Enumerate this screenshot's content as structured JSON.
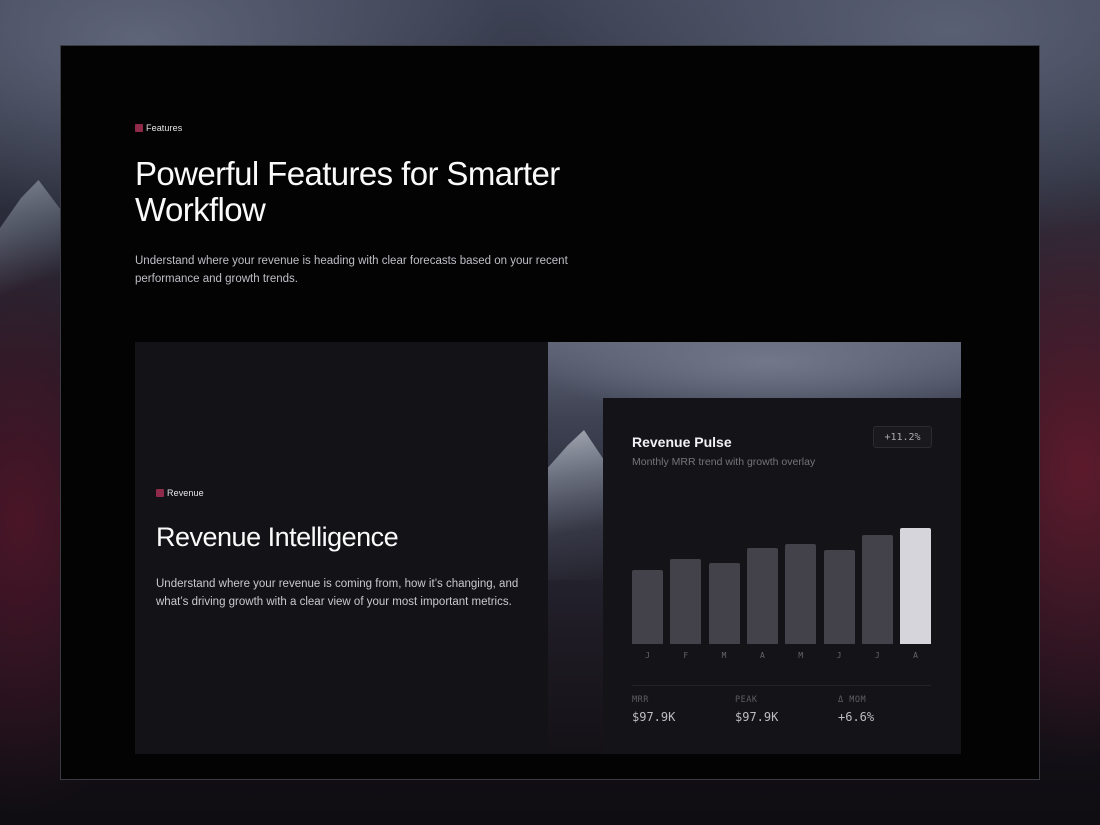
{
  "header": {
    "eyebrow": "Features",
    "title": "Powerful Features for Smarter Workflow",
    "description": "Understand where your revenue is heading with clear forecasts based on your recent performance and growth trends."
  },
  "feature": {
    "eyebrow": "Revenue",
    "title": "Revenue Intelligence",
    "description": "Understand where your revenue is coming from, how it’s changing, and what’s driving growth with a clear view of your most important metrics."
  },
  "colors": {
    "accent": "#8f2a4a",
    "bar": "#434149",
    "bar_highlight": "#d7d5dc"
  },
  "pulse": {
    "title": "Revenue Pulse",
    "subtitle": "Monthly MRR trend with growth overlay",
    "badge": "+11.2%",
    "stats": [
      {
        "label": "MRR",
        "value": "$97.9K"
      },
      {
        "label": "PEAK",
        "value": "$97.9K"
      },
      {
        "label": "Δ MOM",
        "value": "+6.6%"
      }
    ]
  },
  "chart_data": {
    "type": "bar",
    "categories": [
      "J",
      "F",
      "M",
      "A",
      "M",
      "J",
      "J",
      "A"
    ],
    "values": [
      63,
      72,
      69,
      81,
      85,
      80,
      92,
      98
    ],
    "highlight_index": 7,
    "ylim": [
      0,
      100
    ],
    "grid": false
  }
}
